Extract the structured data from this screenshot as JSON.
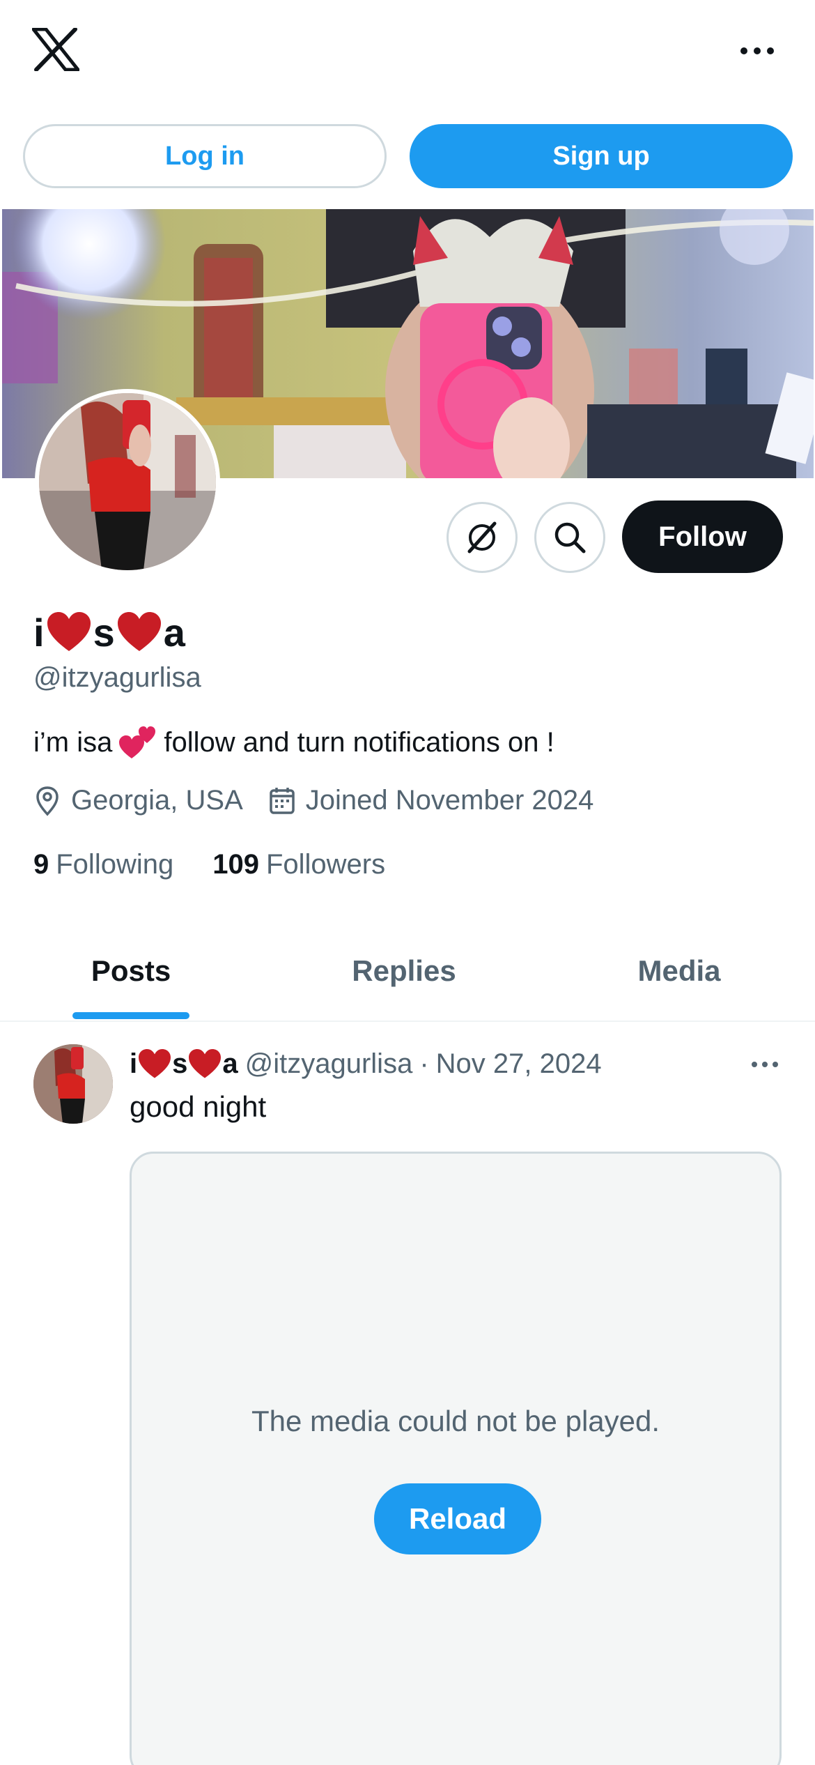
{
  "header": {
    "logo_icon": "x-logo-icon",
    "more_icon": "more-horizontal-icon"
  },
  "auth": {
    "login_label": "Log in",
    "signup_label": "Sign up"
  },
  "profile": {
    "name_parts": [
      "i",
      "s",
      "a"
    ],
    "name_heart_icon": "red-heart-icon",
    "handle": "@itzyagurlisa",
    "bio_before": "i’m isa",
    "bio_emoji_icon": "two-hearts-icon",
    "bio_after": "follow and turn notifications on !",
    "location": "Georgia, USA",
    "joined": "Joined November 2024",
    "following_count": "9",
    "following_label": "Following",
    "followers_count": "109",
    "followers_label": "Followers",
    "follow_label": "Follow"
  },
  "tabs": [
    {
      "label": "Posts",
      "active": true
    },
    {
      "label": "Replies",
      "active": false
    },
    {
      "label": "Media",
      "active": false
    }
  ],
  "post": {
    "name_parts": [
      "i",
      "s",
      "a"
    ],
    "handle": "@itzyagurlisa",
    "separator": "·",
    "date": "Nov 27, 2024",
    "text": "good night",
    "media_message": "The media could not be played.",
    "reload_label": "Reload"
  },
  "colors": {
    "accent": "#1d9bf0",
    "text_primary": "#0f1419",
    "text_secondary": "#536471",
    "heart": "#c81d25"
  }
}
